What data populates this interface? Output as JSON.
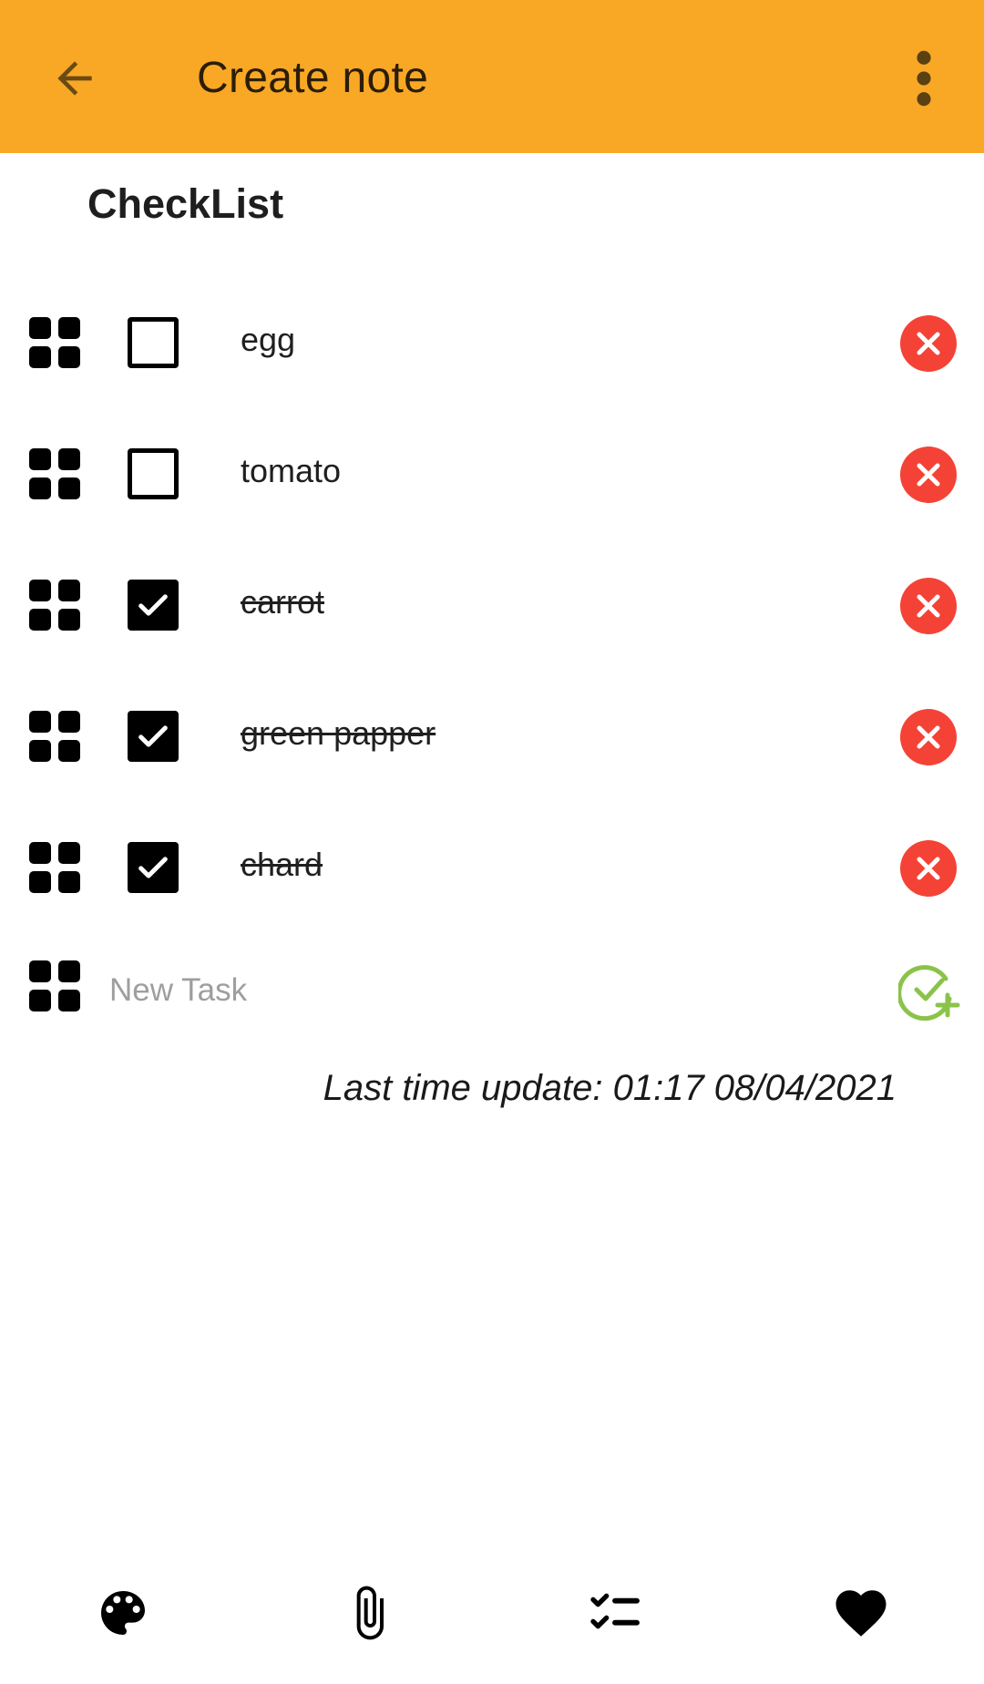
{
  "appbar": {
    "title": "Create note",
    "back_icon": "arrow-back-icon",
    "more_icon": "more-vert-icon",
    "color": "#F9A825"
  },
  "section": {
    "title": "CheckList"
  },
  "items": [
    {
      "label": "egg",
      "checked": false
    },
    {
      "label": "tomato",
      "checked": false
    },
    {
      "label": "carrot",
      "checked": true
    },
    {
      "label": "green papper",
      "checked": true
    },
    {
      "label": "chard",
      "checked": true
    }
  ],
  "new_task": {
    "placeholder": "New Task",
    "value": ""
  },
  "last_update": "Last time update: 01:17 08/04/2021",
  "bottom_bar": [
    "palette-icon",
    "attach-icon",
    "checklist-icon",
    "favorite-icon"
  ],
  "colors": {
    "delete": "#F44336",
    "add": "#8BC34A"
  }
}
